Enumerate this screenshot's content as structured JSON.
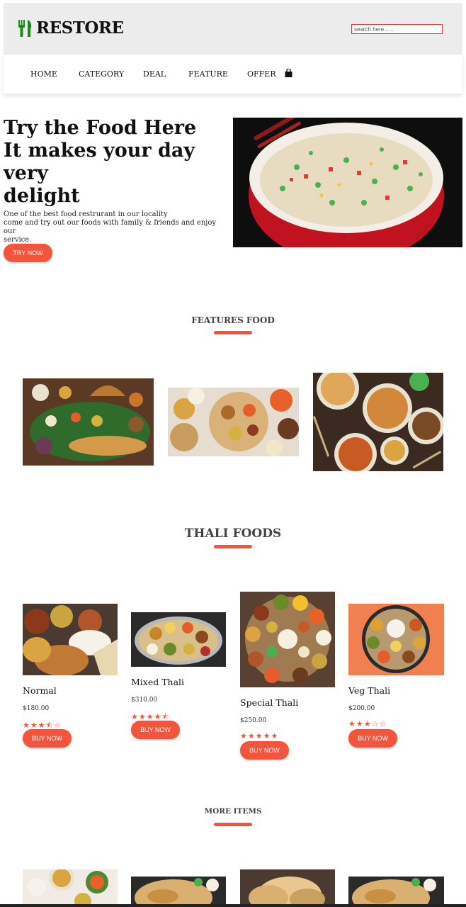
{
  "header": {
    "brand": "RESTORE",
    "logo_icon": "fork-knife-icon",
    "search_placeholder": "search here......"
  },
  "nav": {
    "items": [
      "HOME",
      "CATEGORY",
      "DEAL",
      "FEATURE",
      "OFFER"
    ],
    "cart_icon": "shopping-bag-icon"
  },
  "hero": {
    "title_lines": [
      "Try the Food Here",
      "It makes your day very",
      "delight"
    ],
    "desc_lines": [
      "One of the best food restrurant in our locality",
      "come and try out our foods with family & friends and enjoy our",
      "service."
    ],
    "button": "TRY NOW"
  },
  "features": {
    "title": "FEATURES FOOD"
  },
  "thali": {
    "title": "THALI FOODS",
    "items": [
      {
        "name": "Normal",
        "price": "$180.00",
        "rating": 3.5,
        "stars": "★★★⯪☆",
        "button": "BUY NOW"
      },
      {
        "name": "Mixed Thali",
        "price": "$310.00",
        "rating": 4.5,
        "stars": "★★★★⯪",
        "button": "BUY NOW"
      },
      {
        "name": "Special Thali",
        "price": "$250.00",
        "rating": 5,
        "stars": "★★★★★",
        "button": "BUY NOW"
      },
      {
        "name": "Veg Thali",
        "price": "$200.00",
        "rating": 3,
        "stars": "★★★☆☆",
        "button": "BUY NOW"
      }
    ]
  },
  "more": {
    "title": "MORE ITEMS"
  },
  "colors": {
    "accent": "#f4533c",
    "logo": "#1a8a1a",
    "header_bg": "#ececec"
  }
}
